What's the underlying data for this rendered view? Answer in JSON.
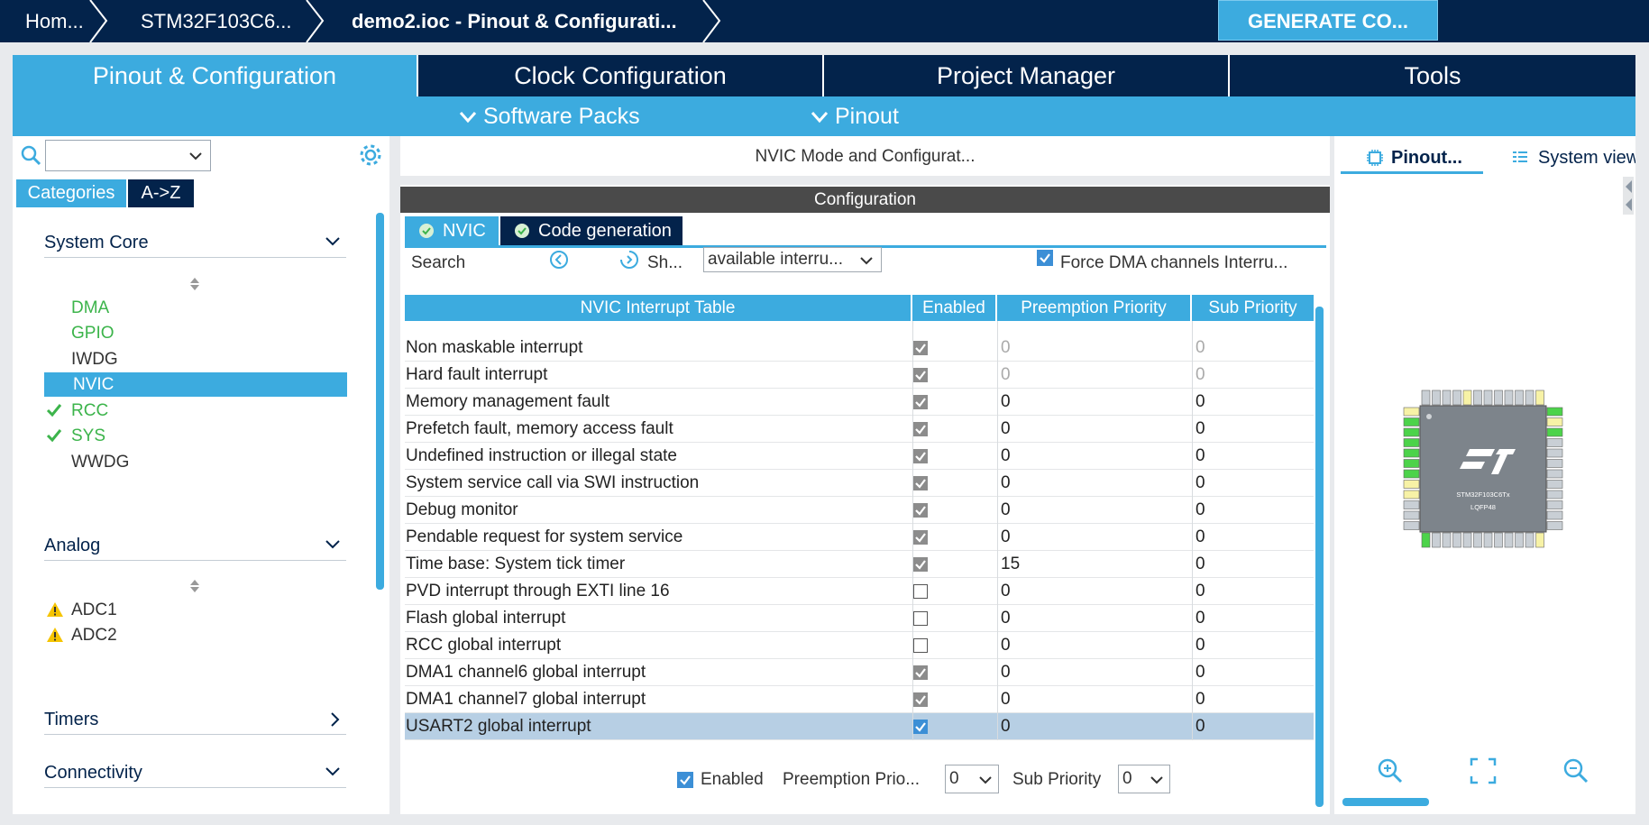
{
  "breadcrumbs": [
    "Hom...",
    "STM32F103C6...",
    "demo2.ioc - Pinout & Configurati..."
  ],
  "generate_label": "GENERATE CO...",
  "main_tabs": [
    "Pinout & Configuration",
    "Clock Configuration",
    "Project Manager",
    "Tools"
  ],
  "sub_menu": [
    "Software Packs",
    "Pinout"
  ],
  "left": {
    "categories_label": "Categories",
    "az_label": "A->Z",
    "sections": [
      {
        "label": "System Core",
        "items": [
          {
            "label": "DMA",
            "status": "green"
          },
          {
            "label": "GPIO",
            "status": "green"
          },
          {
            "label": "IWDG",
            "status": "none"
          },
          {
            "label": "NVIC",
            "status": "selected"
          },
          {
            "label": "RCC",
            "status": "checked"
          },
          {
            "label": "SYS",
            "status": "checked"
          },
          {
            "label": "WWDG",
            "status": "none"
          }
        ]
      },
      {
        "label": "Analog",
        "items": [
          {
            "label": "ADC1",
            "status": "warning"
          },
          {
            "label": "ADC2",
            "status": "warning"
          }
        ]
      },
      {
        "label": "Timers",
        "items": []
      },
      {
        "label": "Connectivity",
        "items": []
      }
    ]
  },
  "center": {
    "title": "NVIC Mode and Configurat...",
    "config_label": "Configuration",
    "subtabs": [
      "NVIC",
      "Code generation"
    ],
    "search_label": "Search",
    "show_label": "Sh...",
    "filter_value": "available interru...",
    "force_dma_label": "Force DMA channels Interru...",
    "table_headers": [
      "NVIC Interrupt Table",
      "Enabled",
      "Preemption Priority",
      "Sub Priority"
    ],
    "rows": [
      {
        "name": "Non maskable interrupt",
        "enabled": true,
        "locked": true,
        "preemption": "0",
        "sub": "0",
        "dim": true
      },
      {
        "name": "Hard fault interrupt",
        "enabled": true,
        "locked": true,
        "preemption": "0",
        "sub": "0",
        "dim": true
      },
      {
        "name": "Memory management fault",
        "enabled": true,
        "locked": true,
        "preemption": "0",
        "sub": "0",
        "dim": false
      },
      {
        "name": "Prefetch fault, memory access fault",
        "enabled": true,
        "locked": true,
        "preemption": "0",
        "sub": "0",
        "dim": false
      },
      {
        "name": "Undefined instruction or illegal state",
        "enabled": true,
        "locked": true,
        "preemption": "0",
        "sub": "0",
        "dim": false
      },
      {
        "name": "System service call via SWI instruction",
        "enabled": true,
        "locked": true,
        "preemption": "0",
        "sub": "0",
        "dim": false
      },
      {
        "name": "Debug monitor",
        "enabled": true,
        "locked": true,
        "preemption": "0",
        "sub": "0",
        "dim": false
      },
      {
        "name": "Pendable request for system service",
        "enabled": true,
        "locked": true,
        "preemption": "0",
        "sub": "0",
        "dim": false
      },
      {
        "name": "Time base: System tick timer",
        "enabled": true,
        "locked": true,
        "preemption": "15",
        "sub": "0",
        "dim": false
      },
      {
        "name": "PVD interrupt through EXTI line 16",
        "enabled": false,
        "locked": false,
        "preemption": "0",
        "sub": "0",
        "dim": false
      },
      {
        "name": "Flash global interrupt",
        "enabled": false,
        "locked": false,
        "preemption": "0",
        "sub": "0",
        "dim": false
      },
      {
        "name": "RCC global interrupt",
        "enabled": false,
        "locked": false,
        "preemption": "0",
        "sub": "0",
        "dim": false
      },
      {
        "name": "DMA1 channel6 global interrupt",
        "enabled": true,
        "locked": true,
        "preemption": "0",
        "sub": "0",
        "dim": false
      },
      {
        "name": "DMA1 channel7 global interrupt",
        "enabled": true,
        "locked": true,
        "preemption": "0",
        "sub": "0",
        "dim": false
      },
      {
        "name": "USART2 global interrupt",
        "enabled": true,
        "locked": false,
        "preemption": "0",
        "sub": "0",
        "dim": false,
        "selected": true
      }
    ],
    "bottom": {
      "enabled_label": "Enabled",
      "preemption_label": "Preemption Prio...",
      "preemption_value": "0",
      "sub_label": "Sub Priority",
      "sub_value": "0"
    }
  },
  "right": {
    "tabs": [
      "Pinout...",
      "System view"
    ],
    "chip": {
      "name": "STM32F103C6Tx",
      "package": "LQFP48"
    }
  },
  "colors": {
    "navy": "#03234b",
    "accent": "#3cabdf",
    "green": "#3cb44b",
    "warning": "#f5c400"
  }
}
